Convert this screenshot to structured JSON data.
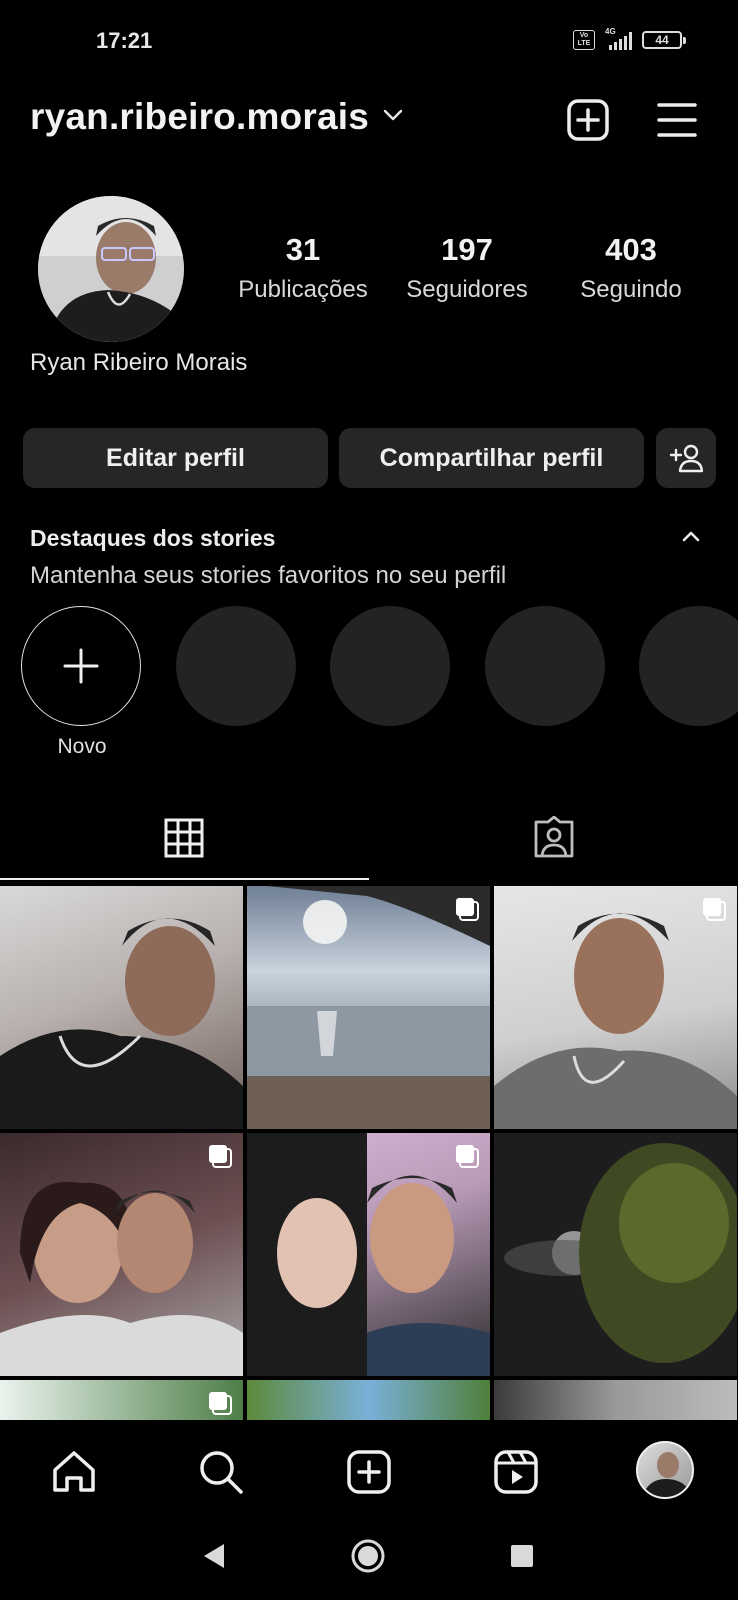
{
  "status_bar": {
    "time": "17:21",
    "network": "4G",
    "volte": "Vo LTE",
    "battery": "44"
  },
  "header": {
    "username": "ryan.ribeiro.morais"
  },
  "profile": {
    "full_name": "Ryan Ribeiro Morais",
    "stats": [
      {
        "value": "31",
        "label": "Publicações"
      },
      {
        "value": "197",
        "label": "Seguidores"
      },
      {
        "value": "403",
        "label": "Seguindo"
      }
    ]
  },
  "actions": {
    "edit_profile": "Editar perfil",
    "share_profile": "Compartilhar perfil"
  },
  "highlights": {
    "title": "Destaques dos stories",
    "subtitle": "Mantenha seus stories favoritos no seu perfil",
    "new_label": "Novo"
  },
  "tabs": [
    {
      "icon": "grid-icon",
      "active": true
    },
    {
      "icon": "tagged-icon",
      "active": false
    }
  ],
  "grid_posts": [
    {
      "subject": "selfie",
      "multi": false
    },
    {
      "subject": "beach",
      "multi": true
    },
    {
      "subject": "selfie",
      "multi": true
    },
    {
      "subject": "couple",
      "multi": true
    },
    {
      "subject": "couple-close",
      "multi": true
    },
    {
      "subject": "night-tree",
      "multi": false
    },
    {
      "subject": "nature",
      "multi": true
    },
    {
      "subject": "outdoor",
      "multi": false
    },
    {
      "subject": "indoor",
      "multi": false
    }
  ],
  "bottom_nav": [
    "home-icon",
    "search-icon",
    "create-icon",
    "reels-icon",
    "profile-avatar"
  ],
  "system_nav": [
    "back-button",
    "home-button",
    "recents-button"
  ]
}
